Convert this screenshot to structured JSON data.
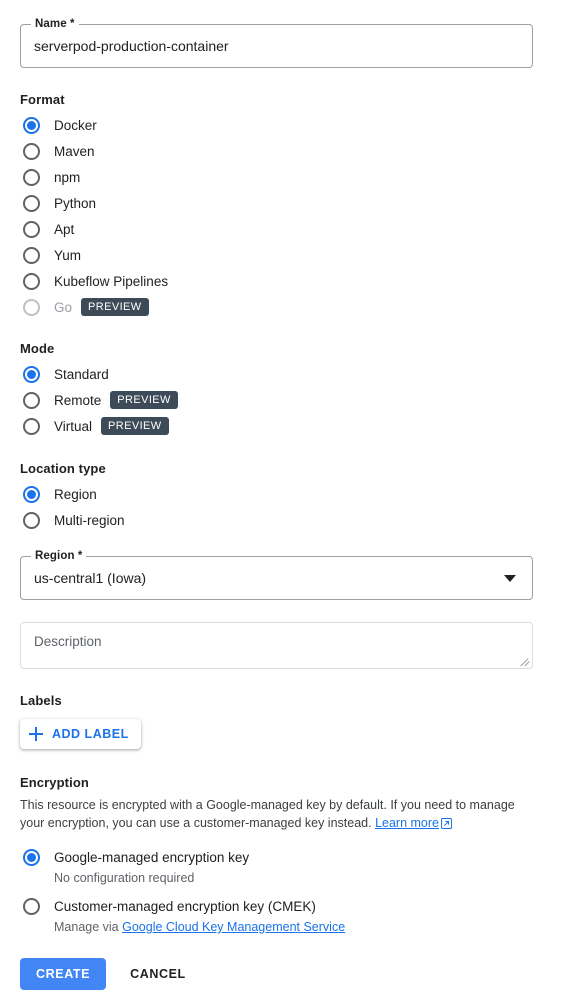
{
  "name_field": {
    "label": "Name *",
    "value": "serverpod-production-container"
  },
  "format": {
    "title": "Format",
    "options": [
      {
        "label": "Docker",
        "selected": true,
        "badge": "",
        "disabled": false
      },
      {
        "label": "Maven",
        "selected": false,
        "badge": "",
        "disabled": false
      },
      {
        "label": "npm",
        "selected": false,
        "badge": "",
        "disabled": false
      },
      {
        "label": "Python",
        "selected": false,
        "badge": "",
        "disabled": false
      },
      {
        "label": "Apt",
        "selected": false,
        "badge": "",
        "disabled": false
      },
      {
        "label": "Yum",
        "selected": false,
        "badge": "",
        "disabled": false
      },
      {
        "label": "Kubeflow Pipelines",
        "selected": false,
        "badge": "",
        "disabled": false
      },
      {
        "label": "Go",
        "selected": false,
        "badge": "PREVIEW",
        "disabled": true
      }
    ]
  },
  "mode": {
    "title": "Mode",
    "options": [
      {
        "label": "Standard",
        "selected": true,
        "badge": "",
        "disabled": false
      },
      {
        "label": "Remote",
        "selected": false,
        "badge": "PREVIEW",
        "disabled": false
      },
      {
        "label": "Virtual",
        "selected": false,
        "badge": "PREVIEW",
        "disabled": false
      }
    ]
  },
  "location_type": {
    "title": "Location type",
    "options": [
      {
        "label": "Region",
        "selected": true,
        "badge": "",
        "disabled": false
      },
      {
        "label": "Multi-region",
        "selected": false,
        "badge": "",
        "disabled": false
      }
    ]
  },
  "region_field": {
    "label": "Region *",
    "value": "us-central1 (Iowa)"
  },
  "description_field": {
    "placeholder": "Description",
    "value": ""
  },
  "labels": {
    "title": "Labels",
    "add_button": "ADD LABEL"
  },
  "encryption": {
    "title": "Encryption",
    "description_part1": "This resource is encrypted with a Google-managed key by default. If you need to manage your encryption, you can use a customer-managed key instead. ",
    "learn_more": "Learn more",
    "options": [
      {
        "label": "Google-managed encryption key",
        "selected": true,
        "sub_text": "No configuration required",
        "sub_link": "",
        "sub_prefix": ""
      },
      {
        "label": "Customer-managed encryption key (CMEK)",
        "selected": false,
        "sub_text": "",
        "sub_prefix": "Manage via ",
        "sub_link": "Google Cloud Key Management Service"
      }
    ]
  },
  "actions": {
    "create": "CREATE",
    "cancel": "CANCEL"
  },
  "colors": {
    "accent_blue": "#1a73e8",
    "button_blue": "#4285f4",
    "badge_bg": "#3c4b57",
    "text_primary": "#202124",
    "text_secondary": "#5f6368"
  }
}
